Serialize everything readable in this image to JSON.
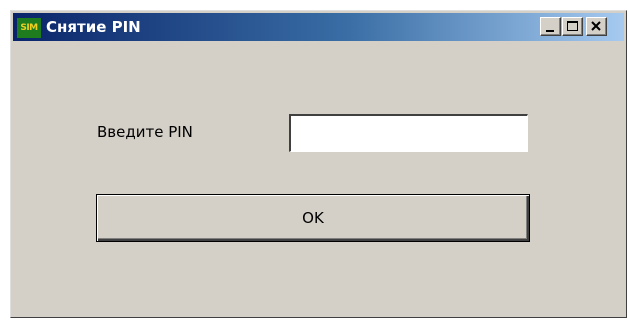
{
  "window": {
    "title": "Снятие PIN",
    "app_icon_text": "SIM",
    "app_icon": "sim-card-icon",
    "caption_buttons": [
      "minimize-icon",
      "maximize-icon",
      "close-icon"
    ]
  },
  "form": {
    "pin_label": "Введите PIN",
    "pin_value": "",
    "pin_placeholder": "",
    "ok_label": "OK"
  },
  "colors": {
    "titlebar_start": "#0a246a",
    "titlebar_end": "#a6caf0",
    "window_background": "#d4d0c8",
    "title_text": "#ffffff",
    "app_icon_background": "#1e7b1e",
    "app_icon_text": "#f0d020"
  }
}
